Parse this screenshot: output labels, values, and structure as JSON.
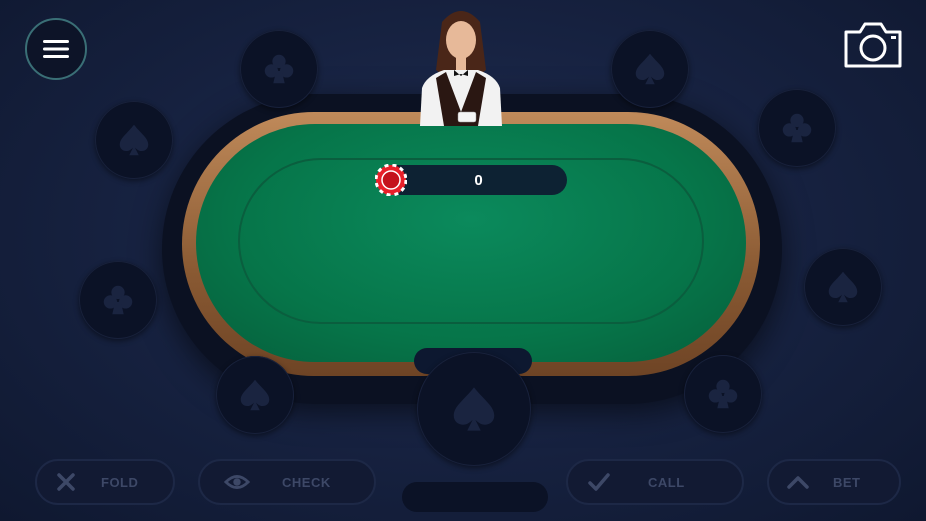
{
  "table": {
    "pot_value": "0",
    "player_name": "-"
  },
  "actions": {
    "fold_label": "FOLD",
    "check_label": "CHECK",
    "call_label": "CALL",
    "bet_label": "BET"
  },
  "icons": {
    "menu": "hamburger-menu-icon",
    "camera": "camera-icon",
    "seat_suits": [
      "club",
      "spade"
    ],
    "fold": "x-icon",
    "check": "eye-icon",
    "call": "checkmark-icon",
    "bet": "chevron-up-icon"
  },
  "colors": {
    "background": "#16213f",
    "felt": "#067549",
    "rail": "#8a5a33",
    "chip": "#e8202a",
    "button_text": "#3d4867"
  }
}
